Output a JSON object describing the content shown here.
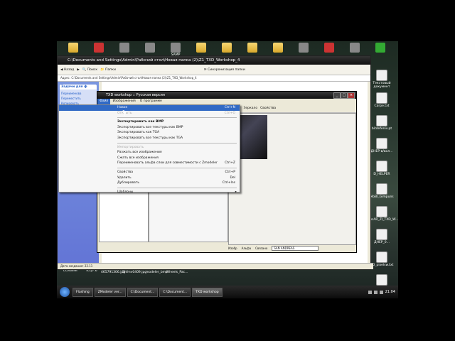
{
  "desktop": {
    "top_icons": [
      {
        "label": "",
        "kind": "folder"
      },
      {
        "label": "",
        "kind": "red"
      },
      {
        "label": "",
        "kind": "gray"
      },
      {
        "label": "",
        "kind": "gray"
      },
      {
        "label": "SAMP",
        "kind": "gray"
      },
      {
        "label": "",
        "kind": "folder"
      },
      {
        "label": "",
        "kind": "folder"
      },
      {
        "label": "",
        "kind": "folder"
      },
      {
        "label": "",
        "kind": "folder"
      },
      {
        "label": "",
        "kind": "gray"
      },
      {
        "label": "",
        "kind": "red"
      },
      {
        "label": "",
        "kind": "gray"
      },
      {
        "label": "",
        "kind": "green"
      }
    ],
    "right_icons": [
      "Текстовый документ",
      "Carpe.txt",
      "bitdefeniv.pt",
      "ДНЕР-в/вол...",
      "D_HELPER",
      "MoBI_Gimpuns",
      "лсAR_ZI_TXD_W...",
      "ДНЕР_0...",
      "ЭD_pixelsw.txt",
      "Корзина"
    ],
    "bottom_icons": [
      "CCleaner",
      "ICQ7.6",
      "465791306.jpg",
      "5hfmv0409.jpg",
      "..modeler_bmp",
      "Wheels_Pac...",
      ""
    ]
  },
  "explorer": {
    "title": "C:\\Documents and Settings\\Admin\\Рабочий стол\\Новая папка (2)\\Z1_TXD_Workshop_4",
    "toolbar": {
      "back": "Назад",
      "search": "Поиск",
      "folders": "Папки",
      "sync": "Синхронизация папки"
    },
    "address_label": "Адрес:",
    "address_value": "C:\\Documents and Settings\\Admin\\Рабочий стол\\Новая папка (2)\\Z1_TXD_Workshop_4",
    "tasks": {
      "file_header": "Задачи для ф",
      "file_items": [
        "Переименова",
        "Переместить",
        "Копировать",
        "Опубликова",
        "Отправить э электронн",
        "Удалить фа"
      ],
      "other_header": "Другие места",
      "other_items": [
        "Новая папка",
        "Мои докумен",
        "Мой компьют",
        "Сетевое окру"
      ],
      "details_header": "Подробно",
      "details_name": "txdworkshop.ex",
      "details_type": "Приложение",
      "details_changed": "Изменен: 25 дек",
      "details_size": "Размер: 396 КБ"
    },
    "status": "Дата создания: 22.11"
  },
  "txd": {
    "title": "TXD workshop :: Русская версия",
    "menu": {
      "file": "Файл",
      "images": "Изображения",
      "about": "О программе"
    },
    "toolbar": {
      "export": "Экспорт",
      "mirror": "Зеркало",
      "properties": "Свойства"
    },
    "bottom": {
      "tab_image": "Изобр",
      "tab_alpha": "Альфа",
      "tab_links": "Связано",
      "game_select": "SAN ANDREAS"
    }
  },
  "dropdown": {
    "items": [
      {
        "label": "Новое",
        "shortcut": "Ctrl+N",
        "style": "hl"
      },
      {
        "label": "Открыть",
        "shortcut": "Ctrl+O",
        "style": "dis"
      },
      {
        "sep": true
      },
      {
        "label": "Экспортировать как BMP",
        "shortcut": "",
        "style": "bold"
      },
      {
        "label": "Экспортировать все текстуры как BMP",
        "shortcut": "",
        "style": ""
      },
      {
        "label": "Экспортировать как TGA",
        "shortcut": "",
        "style": ""
      },
      {
        "label": "Экспортировать все текстуры как TGA",
        "shortcut": "",
        "style": ""
      },
      {
        "sep": true
      },
      {
        "label": "Импортировать",
        "shortcut": "",
        "style": "dis"
      },
      {
        "label": "Разжать все изображения",
        "shortcut": "",
        "style": ""
      },
      {
        "label": "Сжать все изображения",
        "shortcut": "",
        "style": ""
      },
      {
        "label": "Переименовать альфа слои для совместимости с Zmodeler",
        "shortcut": "Ctrl+Z",
        "style": ""
      },
      {
        "sep": true
      },
      {
        "label": "Свойства",
        "shortcut": "Ctrl+P",
        "style": ""
      },
      {
        "label": "Удалить",
        "shortcut": "Del",
        "style": ""
      },
      {
        "label": "Дублировать",
        "shortcut": "Ctrl+Ins",
        "style": ""
      },
      {
        "sep": true
      },
      {
        "label": "Шаблоны",
        "shortcut": "",
        "style": "",
        "submenu": true
      }
    ]
  },
  "taskbar": {
    "buttons": [
      "Flashing",
      "ZModeler ver...",
      "C:\\Document...",
      "C:\\Document...",
      "TXD workshop"
    ],
    "active_index": 4,
    "clock": "21:04"
  }
}
